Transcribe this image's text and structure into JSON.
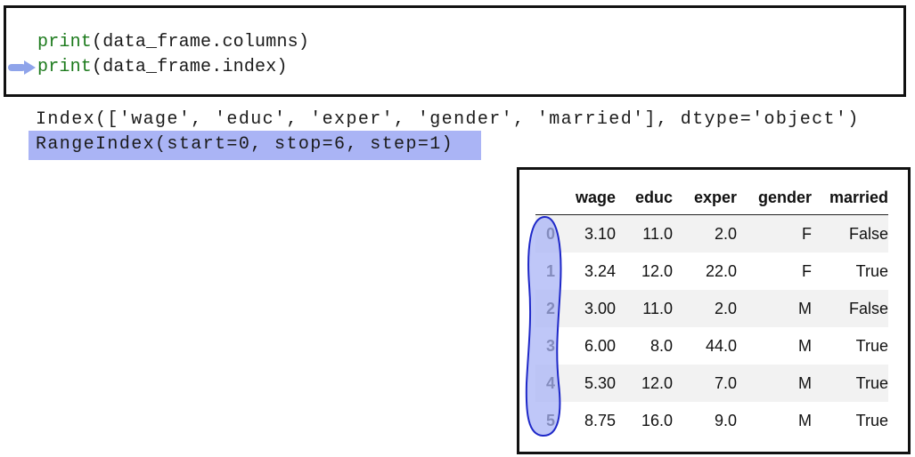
{
  "code_cell": {
    "line1": {
      "fn": "print",
      "args": "(data_frame.columns)"
    },
    "line2": {
      "fn": "print",
      "args": "(data_frame.index)"
    }
  },
  "output": {
    "line1": "Index(['wage', 'educ', 'exper', 'gender', 'married'], dtype='object')",
    "line2": "RangeIndex(start=0, stop=6, step=1)"
  },
  "dataframe": {
    "columns": [
      "wage",
      "educ",
      "exper",
      "gender",
      "married"
    ],
    "rows": [
      {
        "index": "0",
        "wage": "3.10",
        "educ": "11.0",
        "exper": "2.0",
        "gender": "F",
        "married": "False"
      },
      {
        "index": "1",
        "wage": "3.24",
        "educ": "12.0",
        "exper": "22.0",
        "gender": "F",
        "married": "True"
      },
      {
        "index": "2",
        "wage": "3.00",
        "educ": "11.0",
        "exper": "2.0",
        "gender": "M",
        "married": "False"
      },
      {
        "index": "3",
        "wage": "6.00",
        "educ": "8.0",
        "exper": "44.0",
        "gender": "M",
        "married": "True"
      },
      {
        "index": "4",
        "wage": "5.30",
        "educ": "12.0",
        "exper": "7.0",
        "gender": "M",
        "married": "True"
      },
      {
        "index": "5",
        "wage": "8.75",
        "educ": "16.0",
        "exper": "9.0",
        "gender": "M",
        "married": "True"
      }
    ]
  },
  "colors": {
    "highlight": "#aab4f5",
    "arrow": "#8fa4ea",
    "oval_stroke": "#1e28c8",
    "function": "#1c7a1c"
  },
  "icons": {
    "arrow": "execution-arrow-icon",
    "oval": "index-circle-annotation"
  }
}
